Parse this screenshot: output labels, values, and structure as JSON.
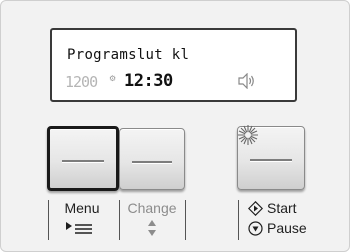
{
  "display": {
    "line1": "Programslut kl",
    "dim_digits": "1200",
    "time": "12:30",
    "sound_icon": "speaker-icon",
    "settings_icon": "gear-icon"
  },
  "buttons": {
    "menu_label": "Menu",
    "change_label": "Change",
    "start_label": "Start",
    "pause_label": "Pause"
  },
  "icons": {
    "menu": "menu-arrow-icon",
    "change": "up-down-icon",
    "start": "diamond-play-icon",
    "pause": "circle-pause-icon",
    "indicator": "sun-indicator-icon"
  },
  "colors": {
    "panel_bg": "#f2f2f2",
    "lcd_bg": "#ffffff",
    "disabled_text": "#8c8c8c"
  }
}
